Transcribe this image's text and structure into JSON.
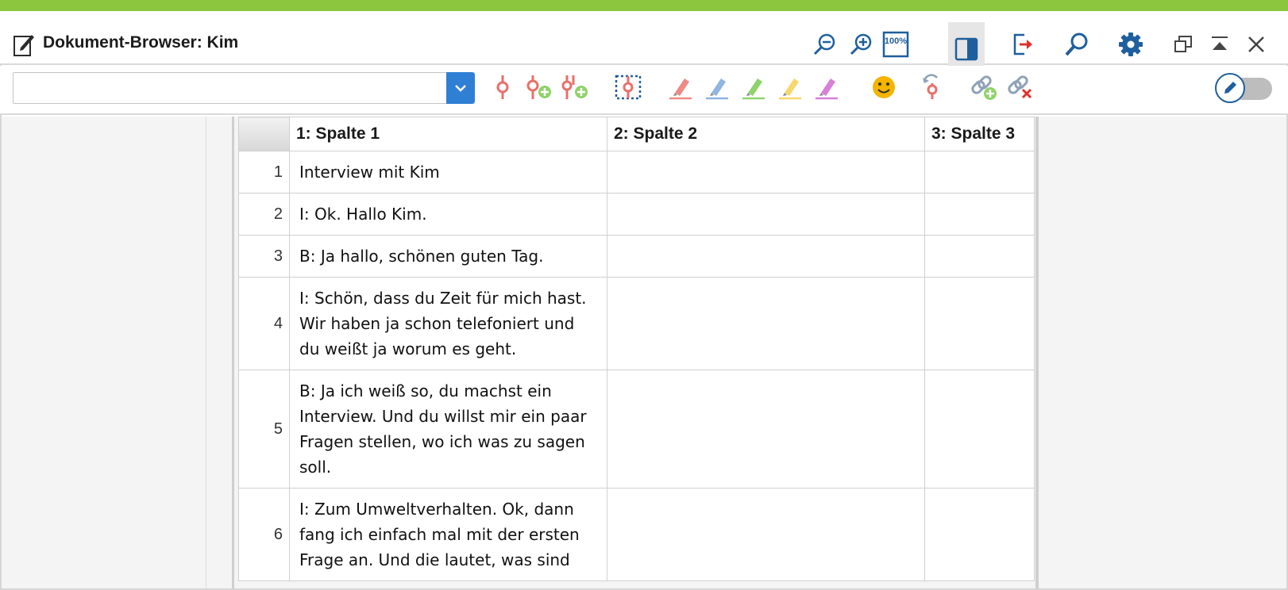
{
  "window": {
    "title": "Dokument-Browser: Kim"
  },
  "titlebar_icons": [
    "zoom-out-icon",
    "zoom-in-icon",
    "zoom-100-icon",
    "side-panel-icon",
    "export-icon",
    "search-icon",
    "gear-icon",
    "restore-window-icon",
    "collapse-window-icon",
    "close-icon"
  ],
  "zoom_100_label": "100%",
  "toolbar": {
    "code_selector": {
      "value": "",
      "placeholder": ""
    },
    "tools": [
      "code-icon",
      "code-new-icon",
      "code-multiple-icon",
      "code-selection-icon",
      "red-highlighter-icon",
      "blue-highlighter-icon",
      "green-highlighter-icon",
      "yellow-highlighter-icon",
      "magenta-highlighter-icon",
      "emoticon-icon",
      "undo-code-icon",
      "add-link-icon",
      "remove-link-icon"
    ],
    "edit_mode_toggle": "off"
  },
  "colors": {
    "accent_bar": "#8cc63f",
    "icon_blue": "#1f5f9e",
    "combo_button": "#2f7fd5",
    "code_red": "#e8706b",
    "highlight_red": "#f08a85",
    "highlight_blue": "#8fb5e0",
    "highlight_green": "#8fd36b",
    "highlight_yellow": "#f5d76e",
    "highlight_magenta": "#d77fd9",
    "emoticon_yellow": "#f4b400"
  },
  "table": {
    "columns": [
      "1: Spalte 1",
      "2: Spalte 2",
      "3: Spalte 3"
    ],
    "rows": [
      {
        "num": "1",
        "cells": [
          "Interview mit Kim",
          "",
          ""
        ]
      },
      {
        "num": "2",
        "cells": [
          "I: Ok. Hallo Kim.",
          "",
          ""
        ]
      },
      {
        "num": "3",
        "cells": [
          "B: Ja hallo, schönen guten Tag.",
          "",
          ""
        ]
      },
      {
        "num": "4",
        "cells": [
          "I: Schön, dass du Zeit für mich hast. Wir haben ja schon telefoniert und du weißt ja worum es geht.",
          "",
          ""
        ]
      },
      {
        "num": "5",
        "cells": [
          "B: Ja ich weiß so, du machst ein Interview. Und du willst mir ein paar Fragen stellen, wo ich was zu sagen soll.",
          "",
          ""
        ]
      },
      {
        "num": "6",
        "cells": [
          "I: Zum Umweltverhalten. Ok, dann fang ich einfach mal mit der ersten Frage an. Und die lautet, was sind",
          "",
          ""
        ]
      }
    ]
  }
}
